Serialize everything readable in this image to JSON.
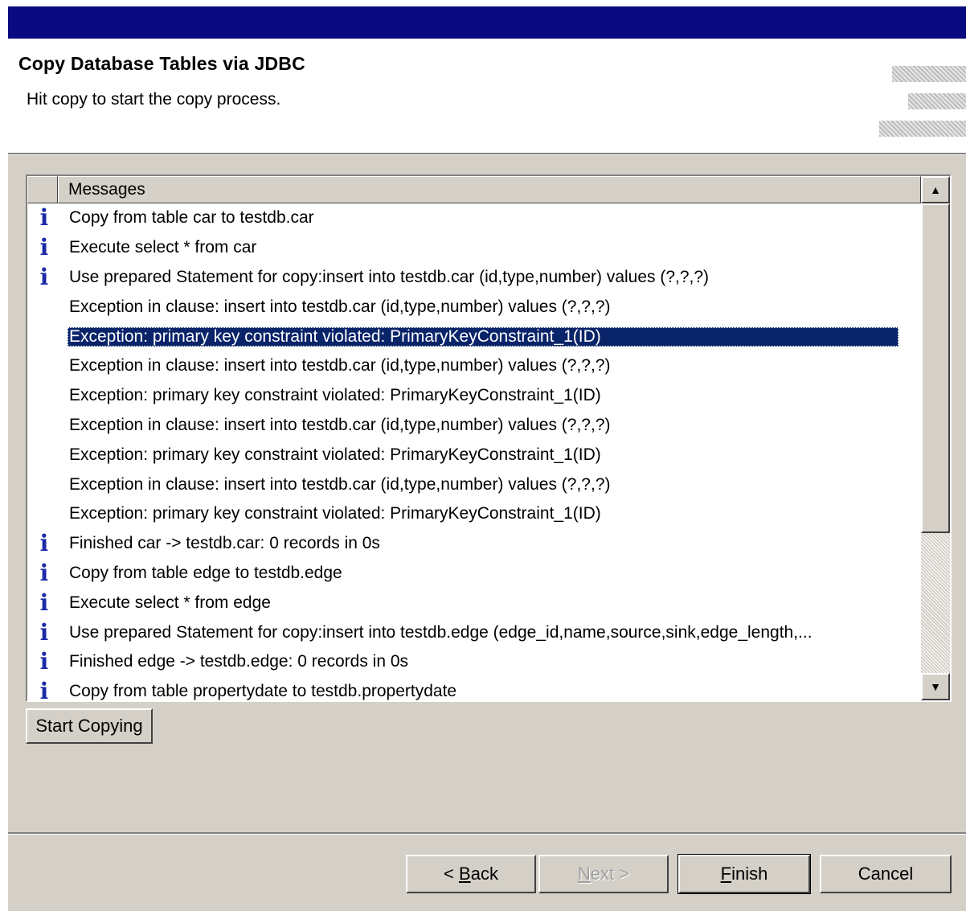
{
  "header": {
    "title": "Copy Database Tables via JDBC",
    "description": "Hit copy to start the copy process."
  },
  "messages": {
    "column_header": "Messages",
    "rows": [
      {
        "icon": "info-icon",
        "text": "Copy from table car to testdb.car"
      },
      {
        "icon": "info-icon",
        "text": "Execute select * from car"
      },
      {
        "icon": "info-icon",
        "text": "Use prepared Statement for copy:insert into testdb.car (id,type,number) values (?,?,?)"
      },
      {
        "icon": "error-icon",
        "text": "Exception in clause: insert into testdb.car (id,type,number) values (?,?,?)"
      },
      {
        "icon": "error-icon",
        "text": "Exception: primary key constraint violated: PrimaryKeyConstraint_1(ID)",
        "selected": true
      },
      {
        "icon": "error-icon",
        "text": "Exception in clause: insert into testdb.car (id,type,number) values (?,?,?)"
      },
      {
        "icon": "error-icon",
        "text": "Exception: primary key constraint violated: PrimaryKeyConstraint_1(ID)"
      },
      {
        "icon": "error-icon",
        "text": "Exception in clause: insert into testdb.car (id,type,number) values (?,?,?)"
      },
      {
        "icon": "error-icon",
        "text": "Exception: primary key constraint violated: PrimaryKeyConstraint_1(ID)"
      },
      {
        "icon": "error-icon",
        "text": "Exception in clause: insert into testdb.car (id,type,number) values (?,?,?)"
      },
      {
        "icon": "error-icon",
        "text": "Exception: primary key constraint violated: PrimaryKeyConstraint_1(ID)"
      },
      {
        "icon": "info-icon",
        "text": "Finished car -> testdb.car: 0 records in 0s"
      },
      {
        "icon": "info-icon",
        "text": "Copy from table edge to testdb.edge"
      },
      {
        "icon": "info-icon",
        "text": "Execute select * from edge"
      },
      {
        "icon": "info-icon",
        "text": "Use prepared Statement for copy:insert into testdb.edge (edge_id,name,source,sink,edge_length,..."
      },
      {
        "icon": "info-icon",
        "text": "Finished edge -> testdb.edge: 0 records in 0s"
      },
      {
        "icon": "info-icon",
        "text": "Copy from table propertydate to testdb.propertydate"
      }
    ]
  },
  "buttons": {
    "start_copying": "Start Copying",
    "back_prefix": "< ",
    "back_key": "B",
    "back_rest": "ack",
    "next_key": "N",
    "next_rest": "ext >",
    "finish_key": "F",
    "finish_rest": "inish",
    "cancel": "Cancel"
  },
  "colors": {
    "title_bar": "#0a0a80",
    "selection": "#0a246a",
    "dialog_face": "#d4d0c8"
  }
}
